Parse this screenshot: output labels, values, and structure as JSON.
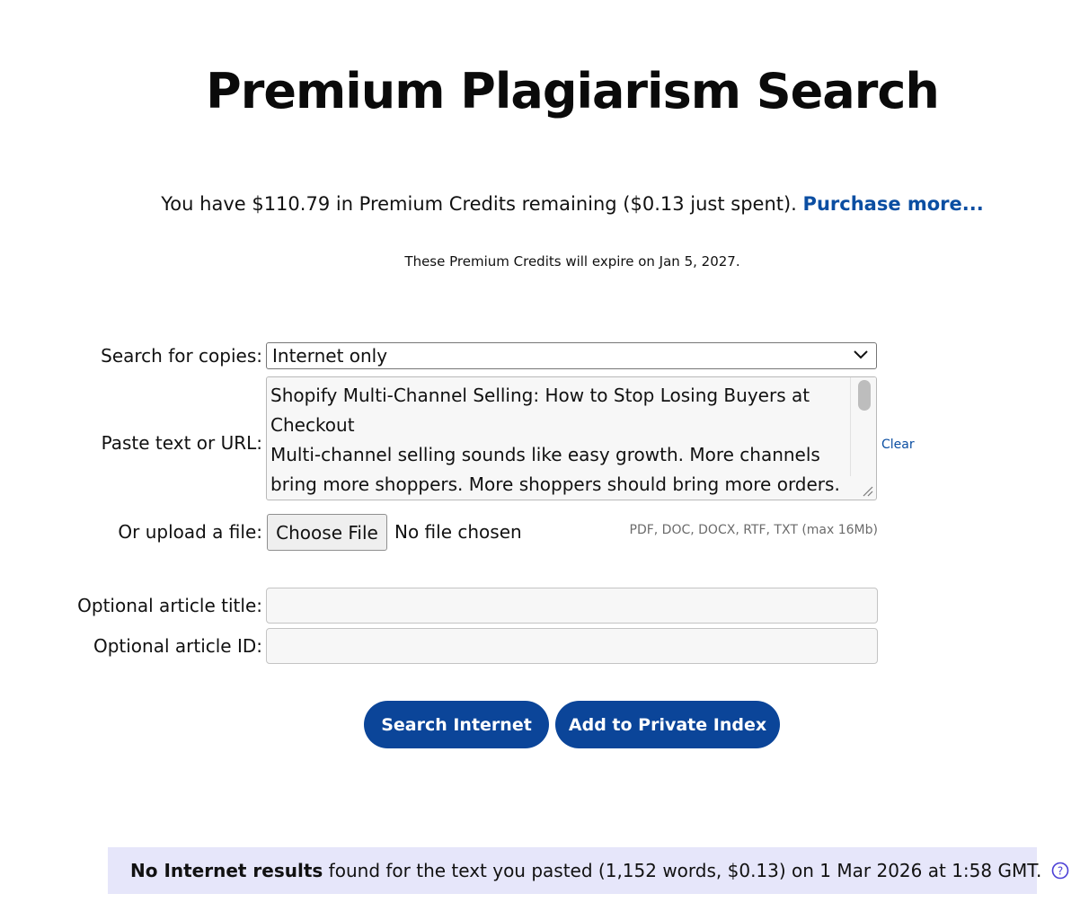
{
  "header": {
    "title": "Premium Plagiarism Search"
  },
  "credits": {
    "prefix": "You have $110.79 in Premium Credits remaining ($0.13 just spent).",
    "purchase_link": "Purchase more...",
    "expiry": "These Premium Credits will expire on Jan 5, 2027."
  },
  "form": {
    "search_for_label": "Search for copies:",
    "search_for_value": "Internet only",
    "paste_label": "Paste text or URL:",
    "paste_text": "Shopify Multi-Channel Selling: How to Stop Losing Buyers at Checkout\nMulti-channel selling sounds like easy growth. More channels bring more shoppers. More shoppers should bring more orders.",
    "clear_link": "Clear",
    "upload_label": "Or upload a file:",
    "choose_file_button": "Choose File",
    "no_file_text": "No file chosen",
    "file_types_hint": "PDF, DOC, DOCX, RTF, TXT (max 16Mb)",
    "article_title_label": "Optional article title:",
    "article_title_value": "",
    "article_id_label": "Optional article ID:",
    "article_id_value": ""
  },
  "actions": {
    "search_button": "Search Internet",
    "add_index_button": "Add to Private Index"
  },
  "results": {
    "bold_text": "No Internet results",
    "rest_text": " found for the text you pasted (1,152 words, $0.13) on 1 Mar 2026 at 1:58 GMT."
  },
  "colors": {
    "accent": "#0b4599",
    "link": "#0b4ea2",
    "banner_bg": "#e6e6fa"
  },
  "icons": {
    "select_arrow": "chevron-down-icon",
    "help": "help-icon"
  }
}
